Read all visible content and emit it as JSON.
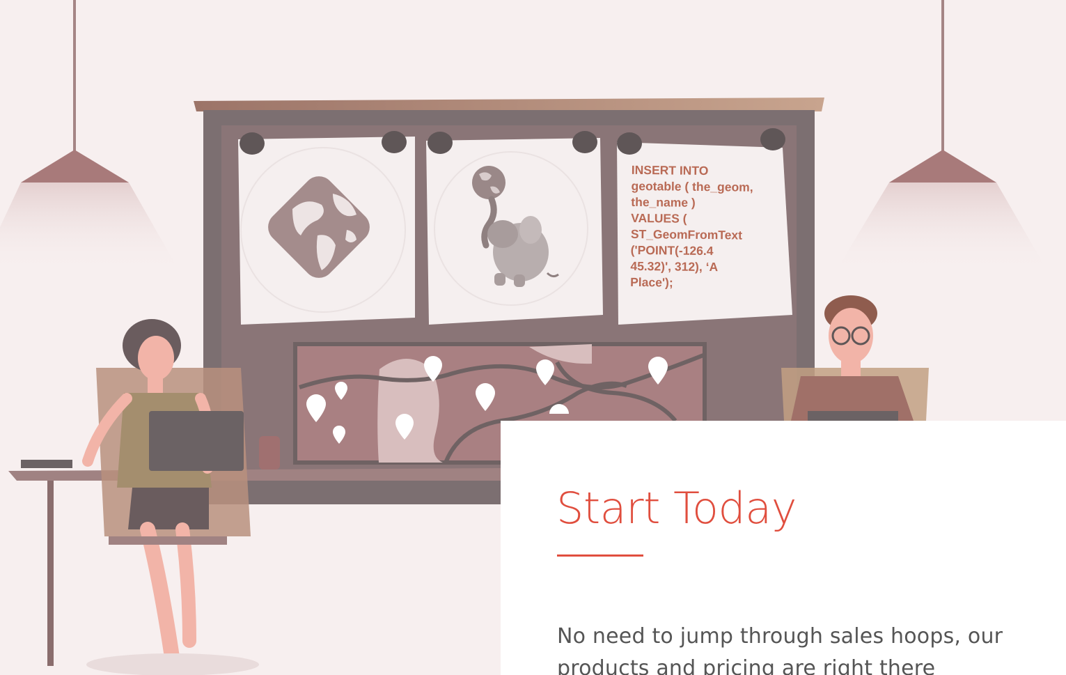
{
  "hero": {
    "note_code": "INSERT INTO\ngeotable ( the_geom,\nthe_name )\n  VALUES (\nST_GeomFromText\n('POINT(-126.4\n45.32)', 312), ‘A\nPlace');"
  },
  "card": {
    "title": "Start Today",
    "body": "No need to jump through sales hoops, our products and pricing are right there"
  },
  "colors": {
    "accent": "#e04e3e",
    "background": "#f7efef",
    "board": "#7c6f71",
    "map": "#a98082"
  },
  "icons": [
    "pendant-lamp-icon",
    "globe-logo-icon",
    "elephant-globe-icon",
    "map-pin-icon"
  ]
}
